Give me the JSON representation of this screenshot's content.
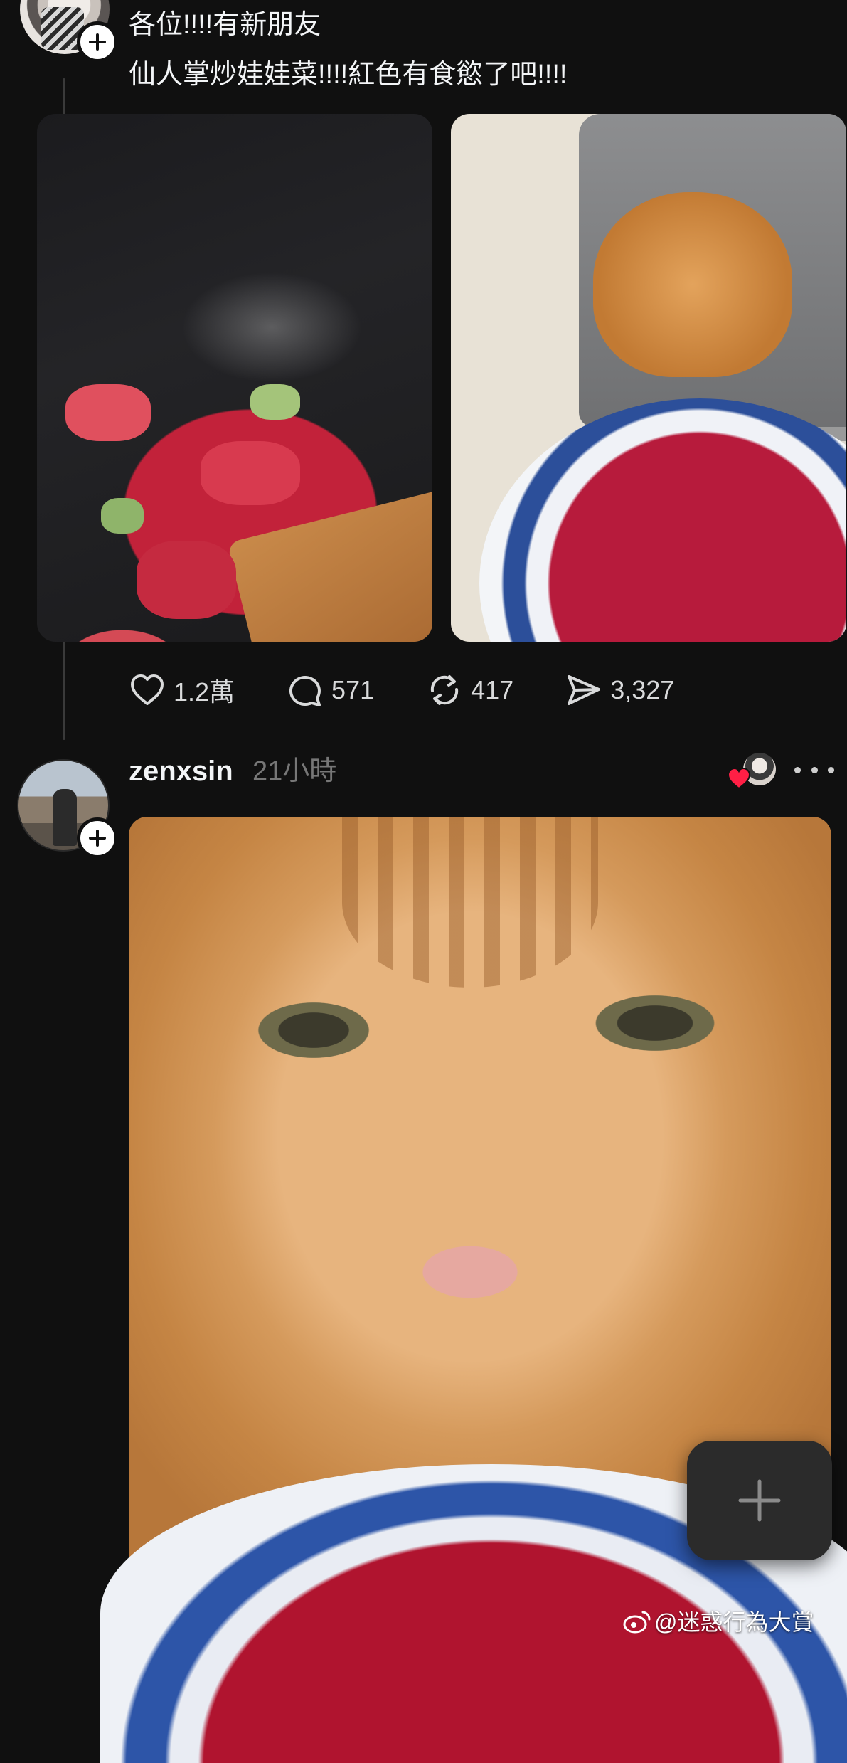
{
  "post1": {
    "text_lines": [
      "各位!!!!有新朋友",
      "仙人掌炒娃娃菜!!!!紅色有食慾了吧!!!!"
    ],
    "images": [
      "stir-fry-in-wok-photo",
      "cat-and-plate-photo"
    ],
    "actions": {
      "likes": "1.2萬",
      "comments": "571",
      "reposts": "417",
      "shares": "3,327"
    }
  },
  "post2": {
    "username": "zenxsin",
    "time": "21小時",
    "image": "cat-closeup-photo"
  },
  "fab": {
    "icon": "plus-icon"
  },
  "watermark": {
    "text": "@迷惑行為大賞"
  },
  "colors": {
    "background": "#101010",
    "text_primary": "#f3f5f7",
    "text_secondary": "#777777",
    "heart_red": "#ff1f45"
  }
}
